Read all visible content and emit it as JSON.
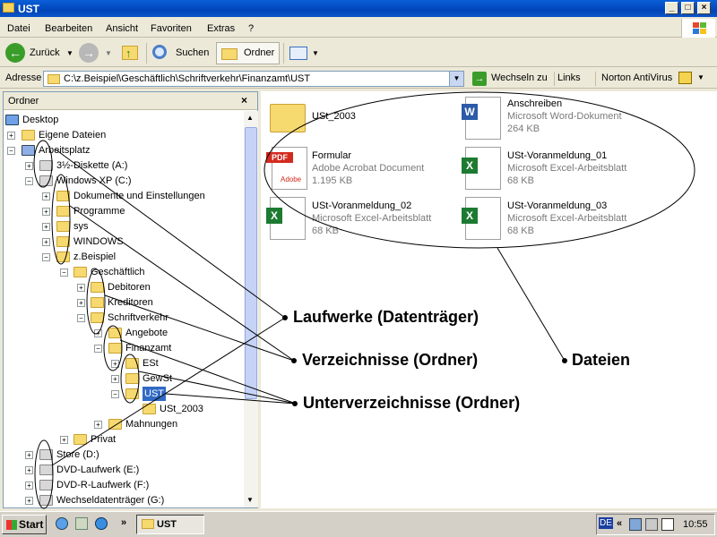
{
  "window": {
    "title": "UST"
  },
  "menu": [
    "Datei",
    "Bearbeiten",
    "Ansicht",
    "Favoriten",
    "Extras",
    "?"
  ],
  "toolbar": {
    "back": "Zurück",
    "search": "Suchen",
    "folders": "Ordner"
  },
  "address": {
    "label": "Adresse",
    "value": "C:\\z.Beispiel\\Geschäftlich\\Schriftverkehr\\Finanzamt\\UST",
    "go": "Wechseln zu",
    "links": "Links",
    "norton": "Norton AntiVirus"
  },
  "tree": {
    "header": "Ordner",
    "items": [
      {
        "label": "Desktop"
      },
      {
        "label": "Eigene Dateien"
      },
      {
        "label": "Arbeitsplatz"
      },
      {
        "label": "3½-Diskette (A:)"
      },
      {
        "label": "Windows XP (C:)"
      },
      {
        "label": "Dokumente und Einstellungen"
      },
      {
        "label": "Programme"
      },
      {
        "label": "sys"
      },
      {
        "label": "WINDOWS"
      },
      {
        "label": "z.Beispiel"
      },
      {
        "label": "Geschäftlich"
      },
      {
        "label": "Debitoren"
      },
      {
        "label": "Kreditoren"
      },
      {
        "label": "Schriftverkehr"
      },
      {
        "label": "Angebote"
      },
      {
        "label": "Finanzamt"
      },
      {
        "label": "ESt"
      },
      {
        "label": "GewSt"
      },
      {
        "label": "UST"
      },
      {
        "label": "USt_2003"
      },
      {
        "label": "Mahnungen"
      },
      {
        "label": "Privat"
      },
      {
        "label": "Store (D:)"
      },
      {
        "label": "DVD-Laufwerk (E:)"
      },
      {
        "label": "DVD-R-Laufwerk (F:)"
      },
      {
        "label": "Wechseldatenträger (G:)"
      }
    ]
  },
  "files": [
    {
      "name": "USt_2003",
      "type": "",
      "size": ""
    },
    {
      "name": "Anschreiben",
      "type": "Microsoft Word-Dokument",
      "size": "264 KB"
    },
    {
      "name": "Formular",
      "type": "Adobe Acrobat Document",
      "size": "1.195 KB"
    },
    {
      "name": "USt-Voranmeldung_01",
      "type": "Microsoft Excel-Arbeitsblatt",
      "size": "68 KB"
    },
    {
      "name": "USt-Voranmeldung_02",
      "type": "Microsoft Excel-Arbeitsblatt",
      "size": "68 KB"
    },
    {
      "name": "USt-Voranmeldung_03",
      "type": "Microsoft Excel-Arbeitsblatt",
      "size": "68 KB"
    }
  ],
  "pdf_badge": "PDF",
  "adobe_label": "Adobe",
  "annotations": {
    "drives": "Laufwerke (Datenträger)",
    "dirs": "Verzeichnisse (Ordner)",
    "subdirs": "Unterverzeichnisse (Ordner)",
    "files": "Dateien"
  },
  "taskbar": {
    "start": "Start",
    "task": "UST",
    "lang": "DE",
    "time": "10:55"
  },
  "colors": {
    "titlebar": "#0a5fd8",
    "selection": "#316ac5",
    "excel": "#1d7a31",
    "word": "#2b5aa8",
    "pdf": "#d32a1e"
  }
}
